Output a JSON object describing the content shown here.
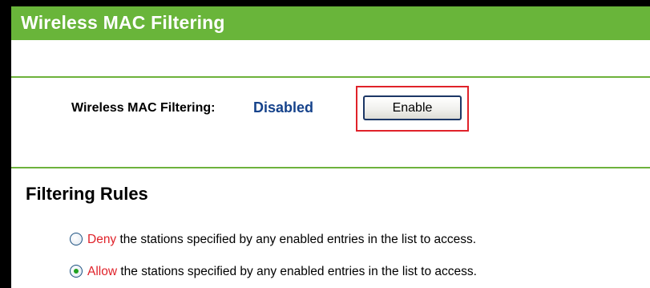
{
  "header": {
    "title": "Wireless MAC Filtering"
  },
  "mac_filtering": {
    "label": "Wireless MAC Filtering:",
    "status": "Disabled",
    "button_label": "Enable"
  },
  "filtering_rules": {
    "title": "Filtering Rules",
    "options": [
      {
        "keyword": "Deny",
        "text": " the stations specified by any enabled entries in the list to access.",
        "selected": false
      },
      {
        "keyword": "Allow",
        "text": " the stations specified by any enabled entries in the list to access.",
        "selected": true
      }
    ]
  },
  "colors": {
    "header_green": "#69b53a",
    "status_blue": "#15428b",
    "keyword_red": "#e0222a",
    "highlight_red": "#e0222a",
    "radio_selected_green": "#21a121"
  }
}
